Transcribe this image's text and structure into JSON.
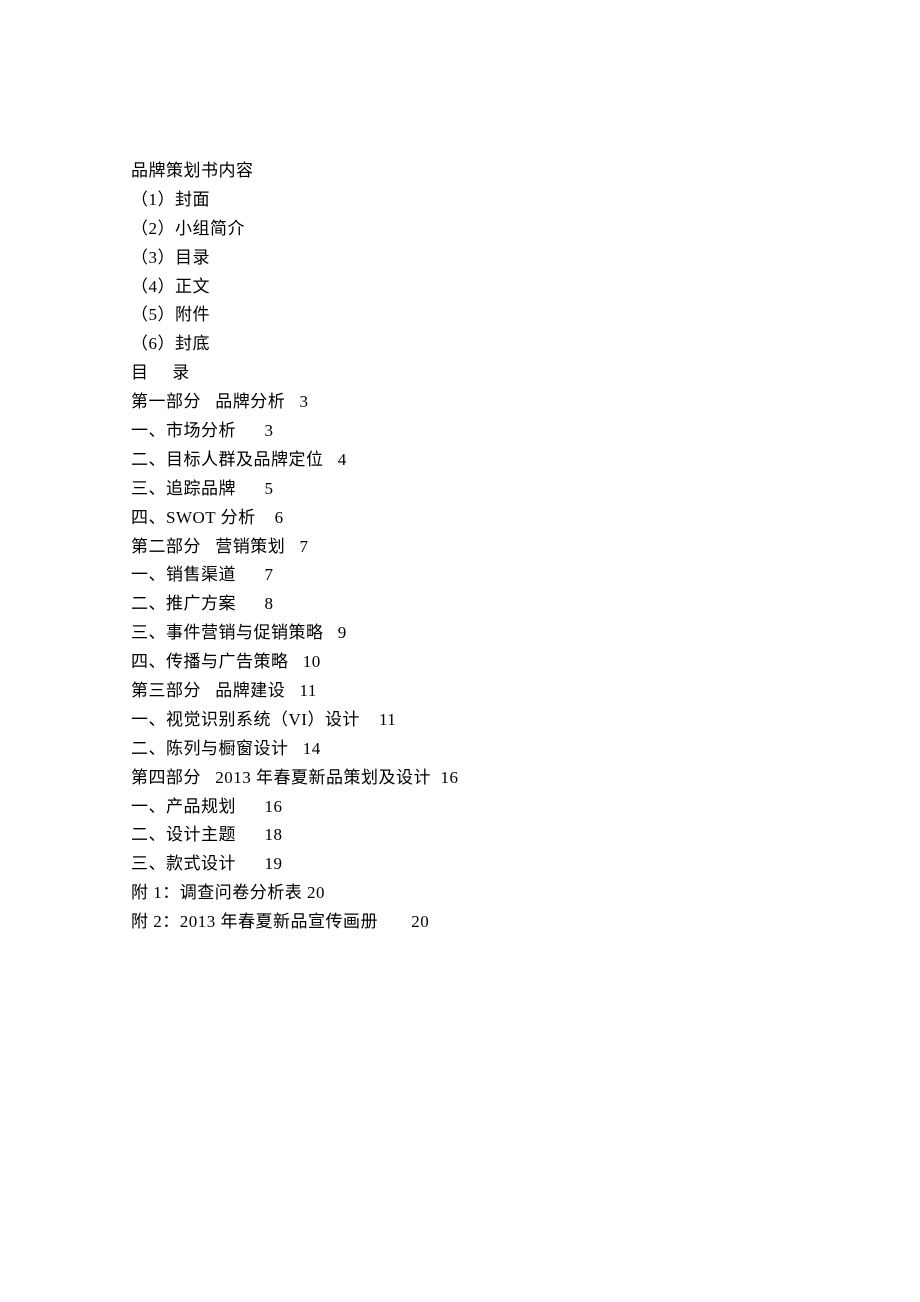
{
  "header": {
    "title": "品牌策划书内容",
    "items": [
      "（1）封面",
      "（2）小组简介",
      "（3）目录",
      "（4）正文",
      "（5）附件",
      "（6）封底"
    ]
  },
  "toc": {
    "title": "目     录",
    "entries": [
      {
        "label": "第一部分   品牌分析",
        "page": "3"
      },
      {
        "label": "一、市场分析",
        "page": "3"
      },
      {
        "label": "二、目标人群及品牌定位",
        "page": "4"
      },
      {
        "label": "三、追踪品牌",
        "page": "5"
      },
      {
        "label": "四、SWOT 分析",
        "page": "6"
      },
      {
        "label": "第二部分   营销策划",
        "page": "7"
      },
      {
        "label": "一、销售渠道",
        "page": "7"
      },
      {
        "label": "二、推广方案",
        "page": "8"
      },
      {
        "label": "三、事件营销与促销策略",
        "page": "9"
      },
      {
        "label": "四、传播与广告策略",
        "page": "10"
      },
      {
        "label": "第三部分   品牌建设",
        "page": "11"
      },
      {
        "label": "一、视觉识别系统（VI）设计",
        "page": "11"
      },
      {
        "label": "二、陈列与橱窗设计",
        "page": "14"
      },
      {
        "label": "第四部分   2013 年春夏新品策划及设计",
        "page": "16"
      },
      {
        "label": "一、产品规划",
        "page": "16"
      },
      {
        "label": "二、设计主题",
        "page": "18"
      },
      {
        "label": "三、款式设计",
        "page": "19"
      },
      {
        "label": "附 1：调查问卷分析表",
        "page": "20"
      },
      {
        "label": "附 2：2013 年春夏新品宣传画册",
        "page": "20"
      }
    ],
    "gaps": [
      "   ",
      "      ",
      "   ",
      "      ",
      "    ",
      "   ",
      "      ",
      "      ",
      "   ",
      "   ",
      "   ",
      "    ",
      "   ",
      "  ",
      "      ",
      "      ",
      "      ",
      " ",
      "       "
    ]
  }
}
